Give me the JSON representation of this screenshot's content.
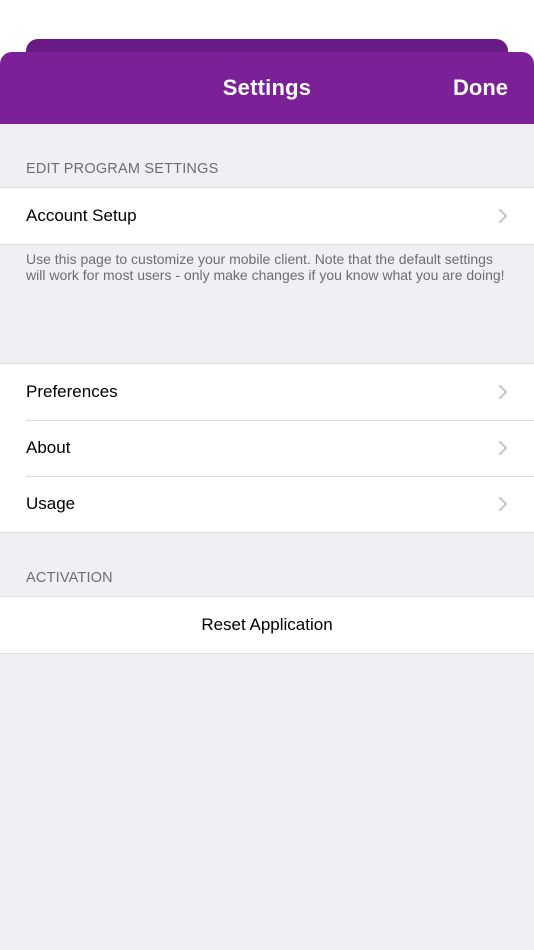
{
  "navbar": {
    "title": "Settings",
    "done_label": "Done"
  },
  "sections": {
    "program": {
      "header": "EDIT PROGRAM SETTINGS",
      "account_setup_label": "Account Setup",
      "footer": "Use this page to customize your mobile client. Note that the default settings will work for most users - only make changes if you know what you are doing!"
    },
    "general": {
      "preferences_label": "Preferences",
      "about_label": "About",
      "usage_label": "Usage"
    },
    "activation": {
      "header": "ACTIVATION",
      "reset_label": "Reset Application"
    }
  },
  "colors": {
    "accent": "#7b2096",
    "accent_dark": "#6a1a84",
    "background": "#f0eff4"
  },
  "icons": {
    "chevron": "chevron-right-icon"
  }
}
